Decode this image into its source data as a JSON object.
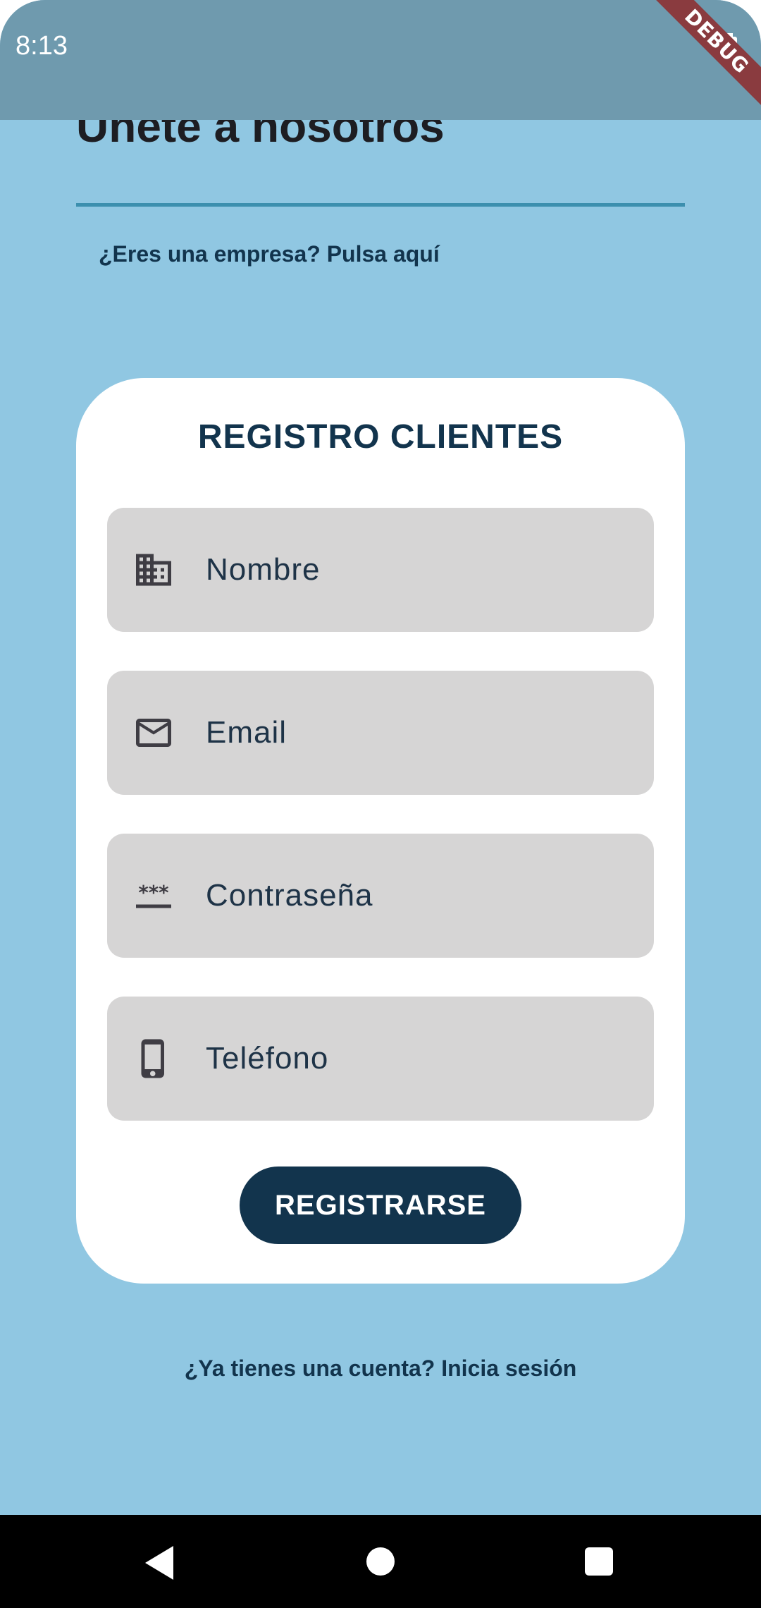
{
  "status_bar": {
    "time": "8:13",
    "debug_label": "DEBUG"
  },
  "header": {
    "title": "Únete a nosotros",
    "business_link": "¿Eres una empresa? Pulsa aquí"
  },
  "form": {
    "title": "REGISTRO CLIENTES",
    "fields": [
      {
        "placeholder": "Nombre",
        "icon": "building-icon"
      },
      {
        "placeholder": "Email",
        "icon": "mail-icon"
      },
      {
        "placeholder": "Contraseña",
        "icon": "password-icon"
      },
      {
        "placeholder": "Teléfono",
        "icon": "phone-icon"
      }
    ],
    "submit_label": "REGISTRARSE"
  },
  "footer": {
    "login_link": "¿Ya tienes una cuenta? Inicia sesión"
  },
  "nav": {
    "icons": [
      "back-icon",
      "home-icon",
      "recents-icon"
    ]
  },
  "colors": {
    "background": "#90c7e2",
    "status_bar": "#6f9aae",
    "primary": "#12344d",
    "field_bg": "#d6d5d5",
    "divider": "#3c8fae"
  }
}
